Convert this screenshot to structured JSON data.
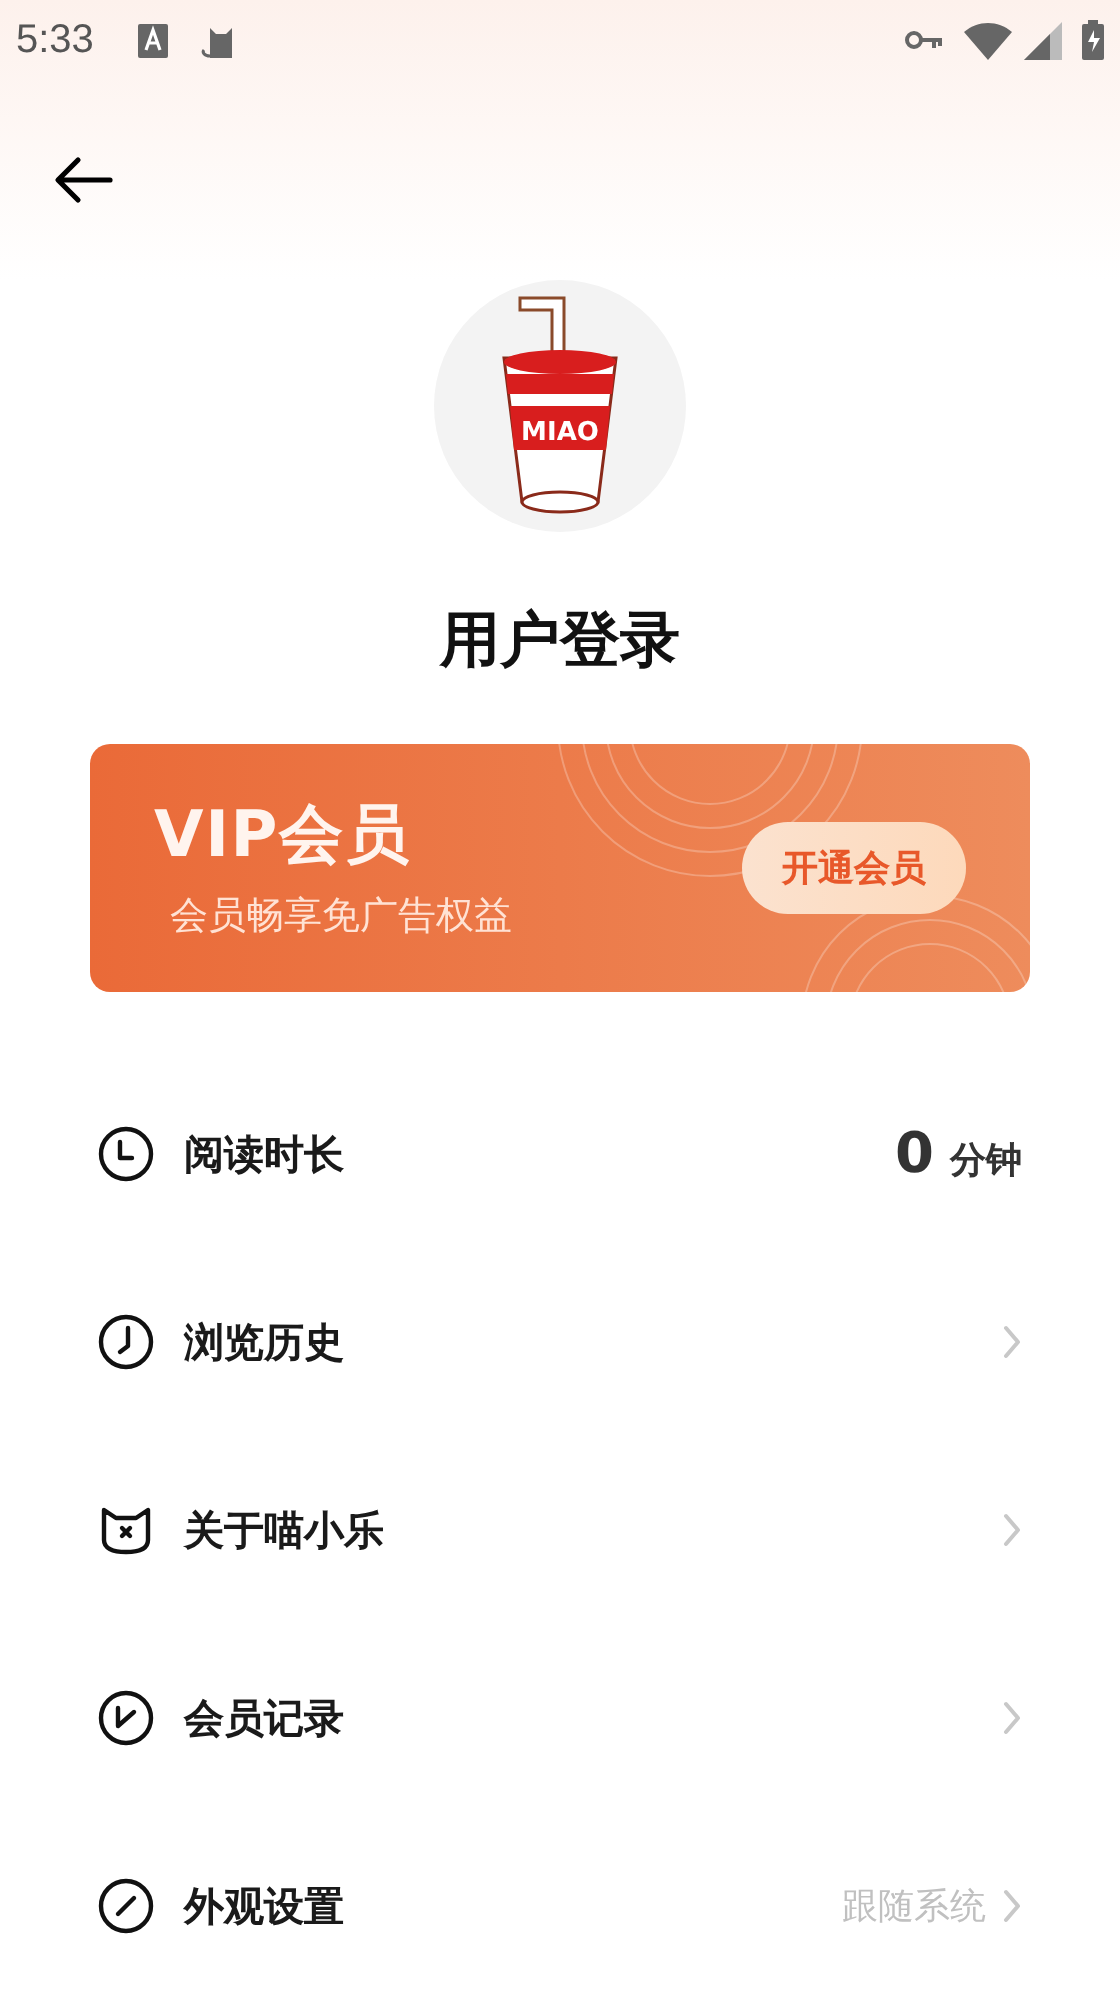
{
  "status_bar": {
    "time": "5:33"
  },
  "header": {
    "logo_text": "MIAO",
    "title": "用户登录"
  },
  "vip_card": {
    "title": "VIP会员",
    "subtitle": "会员畅享免广告权益",
    "button": "开通会员"
  },
  "menu": [
    {
      "kind": "value",
      "label": "阅读时长",
      "value": "0",
      "unit": "分钟"
    },
    {
      "kind": "link",
      "label": "浏览历史"
    },
    {
      "kind": "link",
      "label": "关于喵小乐"
    },
    {
      "kind": "link",
      "label": "会员记录"
    },
    {
      "kind": "link",
      "label": "外观设置",
      "value": "跟随系统"
    }
  ]
}
